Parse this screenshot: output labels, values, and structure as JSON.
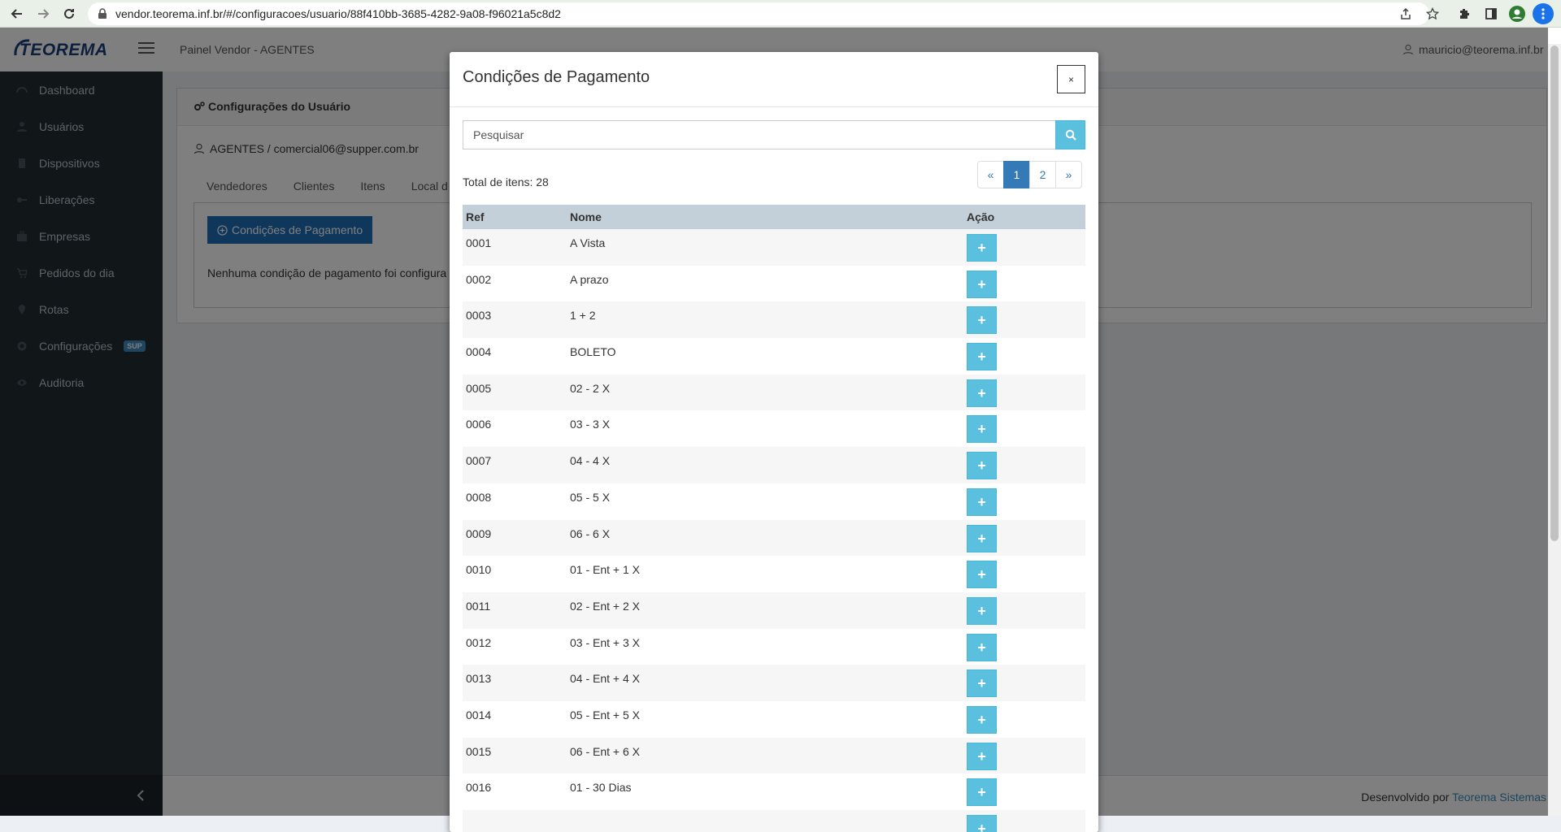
{
  "browser": {
    "url": "vendor.teorema.inf.br/#/configuracoes/usuario/88f410bb-3685-4282-9a08-f96021a5c8d2"
  },
  "header": {
    "logo": "TEOREMA",
    "title": "Painel Vendor - AGENTES",
    "user": "mauricio@teorema.inf.br"
  },
  "sidebar": {
    "items": [
      {
        "label": "Dashboard",
        "icon": "dashboard-icon"
      },
      {
        "label": "Usuários",
        "icon": "users-icon"
      },
      {
        "label": "Dispositivos",
        "icon": "mobile-icon"
      },
      {
        "label": "Liberações",
        "icon": "key-icon"
      },
      {
        "label": "Empresas",
        "icon": "briefcase-icon"
      },
      {
        "label": "Pedidos do dia",
        "icon": "cart-icon"
      },
      {
        "label": "Rotas",
        "icon": "map-marker-icon"
      },
      {
        "label": "Configurações",
        "icon": "gear-icon",
        "badge": "SUP"
      },
      {
        "label": "Auditoria",
        "icon": "eye-icon"
      }
    ]
  },
  "content": {
    "box_title": "Configurações do Usuário",
    "user_line": "AGENTES / comercial06@supper.com.br",
    "tabs": [
      "Vendedores",
      "Clientes",
      "Itens",
      "Local d"
    ],
    "button": "Condições de Pagamento",
    "empty_message": "Nenhuma condição de pagamento foi configura"
  },
  "footer": {
    "prefix": "Desenvolvido por",
    "link": "Teorema Sistemas"
  },
  "modal": {
    "title": "Condições de Pagamento",
    "close": "×",
    "search_placeholder": "Pesquisar",
    "total": "Total de itens: 28",
    "pagination": [
      "«",
      "1",
      "2",
      "»"
    ],
    "active_page": "1",
    "columns": {
      "ref": "Ref",
      "nome": "Nome",
      "acao": "Ação"
    },
    "rows": [
      {
        "ref": "0001",
        "nome": "A Vista"
      },
      {
        "ref": "0002",
        "nome": "A prazo"
      },
      {
        "ref": "0003",
        "nome": "1 + 2"
      },
      {
        "ref": "0004",
        "nome": "BOLETO"
      },
      {
        "ref": "0005",
        "nome": "02 - 2 X"
      },
      {
        "ref": "0006",
        "nome": "03 - 3 X"
      },
      {
        "ref": "0007",
        "nome": "04 - 4 X"
      },
      {
        "ref": "0008",
        "nome": "05 - 5 X"
      },
      {
        "ref": "0009",
        "nome": "06 - 6 X"
      },
      {
        "ref": "0010",
        "nome": "01 - Ent + 1 X"
      },
      {
        "ref": "0011",
        "nome": "02 - Ent + 2 X"
      },
      {
        "ref": "0012",
        "nome": "03 - Ent + 3 X"
      },
      {
        "ref": "0013",
        "nome": "04 - Ent + 4 X"
      },
      {
        "ref": "0014",
        "nome": "05 - Ent + 5 X"
      },
      {
        "ref": "0015",
        "nome": "06 - Ent + 6 X"
      },
      {
        "ref": "0016",
        "nome": "01 - 30 Dias"
      },
      {
        "ref": "",
        "nome": ""
      }
    ],
    "add_label": "+"
  }
}
